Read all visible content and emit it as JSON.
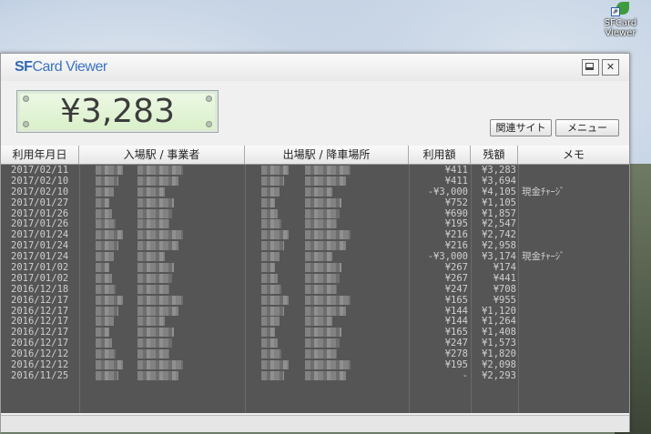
{
  "desktop": {
    "icon_label": "SFCard Viewer"
  },
  "window": {
    "title_sf": "SF",
    "title_rest": "Card Viewer",
    "minimize_icon": "window-minimize-icon",
    "close_icon": "close-icon"
  },
  "balance": {
    "value": "¥3,283"
  },
  "buttons": {
    "related_sites": "関連サイト",
    "menu": "メニュー"
  },
  "table": {
    "headers": [
      "利用年月日",
      "入場駅 / 事業者",
      "出場駅 / 降車場所",
      "利用額",
      "残額",
      "メモ"
    ],
    "rows": [
      {
        "date": "2017/02/11",
        "amount": "¥411",
        "balance": "¥3,283",
        "memo": ""
      },
      {
        "date": "2017/02/10",
        "amount": "¥411",
        "balance": "¥3,694",
        "memo": ""
      },
      {
        "date": "2017/02/10",
        "amount": "-¥3,000",
        "balance": "¥4,105",
        "memo": "現金ﾁｬｰｼﾞ"
      },
      {
        "date": "2017/01/27",
        "amount": "¥752",
        "balance": "¥1,105",
        "memo": ""
      },
      {
        "date": "2017/01/26",
        "amount": "¥690",
        "balance": "¥1,857",
        "memo": ""
      },
      {
        "date": "2017/01/26",
        "amount": "¥195",
        "balance": "¥2,547",
        "memo": ""
      },
      {
        "date": "2017/01/24",
        "amount": "¥216",
        "balance": "¥2,742",
        "memo": ""
      },
      {
        "date": "2017/01/24",
        "amount": "¥216",
        "balance": "¥2,958",
        "memo": ""
      },
      {
        "date": "2017/01/24",
        "amount": "-¥3,000",
        "balance": "¥3,174",
        "memo": "現金ﾁｬｰｼﾞ"
      },
      {
        "date": "2017/01/02",
        "amount": "¥267",
        "balance": "¥174",
        "memo": ""
      },
      {
        "date": "2017/01/02",
        "amount": "¥267",
        "balance": "¥441",
        "memo": ""
      },
      {
        "date": "2016/12/18",
        "amount": "¥247",
        "balance": "¥708",
        "memo": ""
      },
      {
        "date": "2016/12/17",
        "amount": "¥165",
        "balance": "¥955",
        "memo": ""
      },
      {
        "date": "2016/12/17",
        "amount": "¥144",
        "balance": "¥1,120",
        "memo": ""
      },
      {
        "date": "2016/12/17",
        "amount": "¥144",
        "balance": "¥1,264",
        "memo": ""
      },
      {
        "date": "2016/12/17",
        "amount": "¥165",
        "balance": "¥1,408",
        "memo": ""
      },
      {
        "date": "2016/12/17",
        "amount": "¥247",
        "balance": "¥1,573",
        "memo": ""
      },
      {
        "date": "2016/12/12",
        "amount": "¥278",
        "balance": "¥1,820",
        "memo": ""
      },
      {
        "date": "2016/12/12",
        "amount": "¥195",
        "balance": "¥2,098",
        "memo": ""
      },
      {
        "date": "2016/11/25",
        "amount": "-",
        "balance": "¥2,293",
        "memo": ""
      }
    ]
  }
}
